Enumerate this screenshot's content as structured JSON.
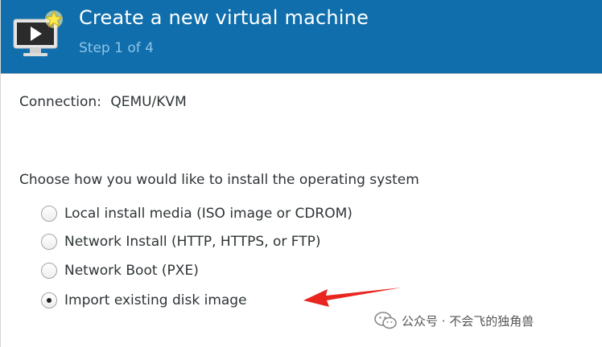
{
  "header": {
    "title": "Create a new virtual machine",
    "step": "Step 1 of 4",
    "icon": "monitor-play-star-icon"
  },
  "connection": {
    "label": "Connection:",
    "value": "QEMU/KVM"
  },
  "install": {
    "prompt": "Choose how you would like to install the operating system",
    "options": [
      {
        "label": "Local install media (ISO image or CDROM)",
        "selected": false
      },
      {
        "label": "Network Install (HTTP, HTTPS, or FTP)",
        "selected": false
      },
      {
        "label": "Network Boot (PXE)",
        "selected": false
      },
      {
        "label": "Import existing disk image",
        "selected": true
      }
    ]
  },
  "annotation": {
    "arrow_color": "#e8251f",
    "icon": "red-arrow-icon"
  },
  "watermark": {
    "icon": "wechat-icon",
    "text": "公众号 · 不会飞的独角兽"
  },
  "colors": {
    "header_bg": "#0f6eab",
    "header_title": "#ffffff",
    "header_step": "#8ec4e8"
  }
}
